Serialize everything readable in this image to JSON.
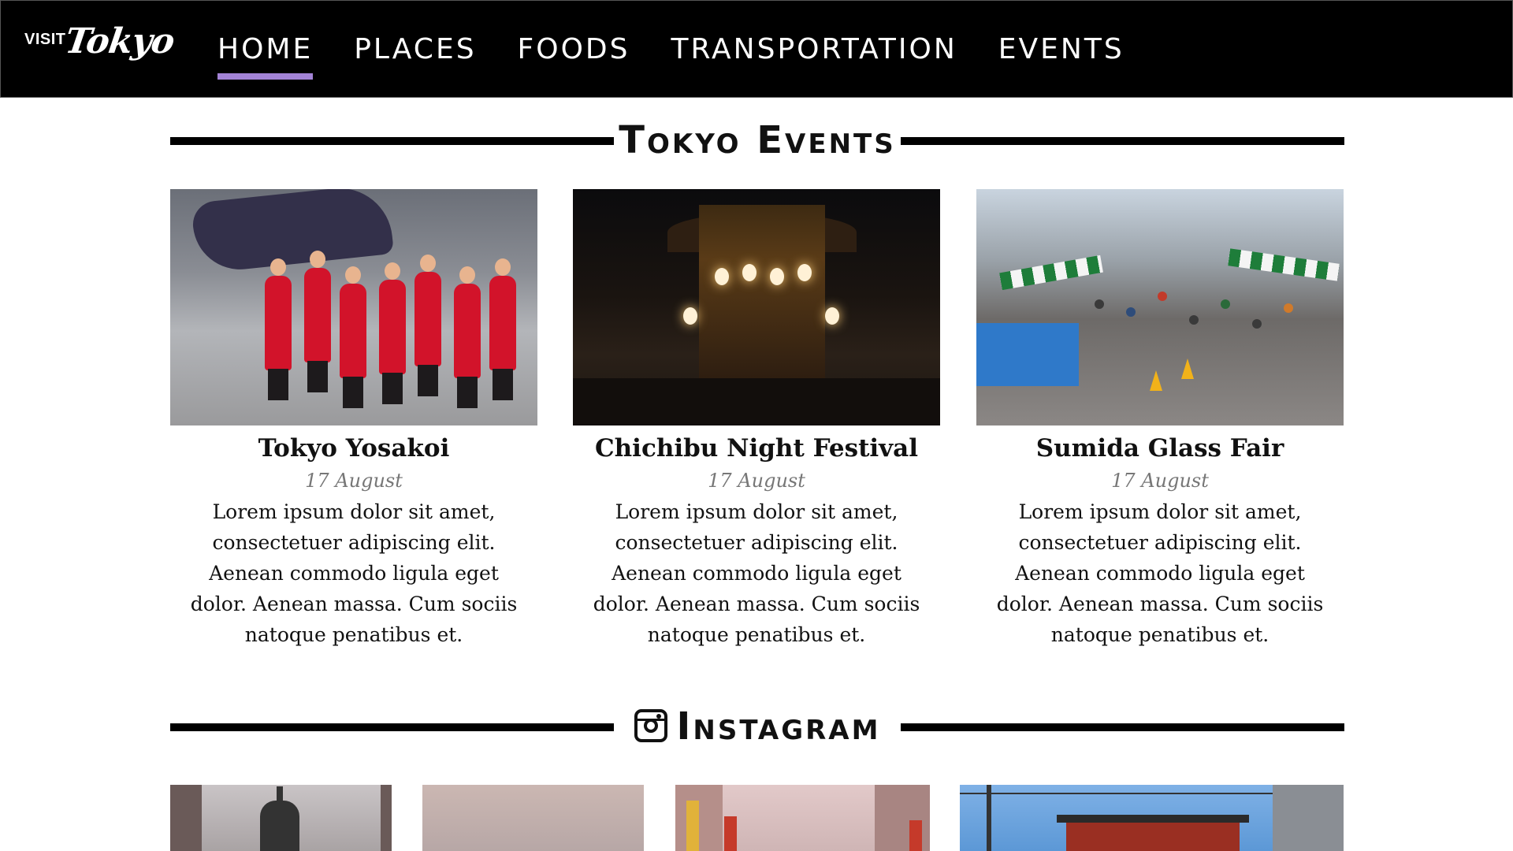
{
  "header": {
    "logo": {
      "visit": "VISIT",
      "tokyo": "Tokyo"
    },
    "nav": [
      {
        "label": "HOME",
        "active": true
      },
      {
        "label": "PLACES",
        "active": false
      },
      {
        "label": "FOODS",
        "active": false
      },
      {
        "label": "TRANSPORTATION",
        "active": false
      },
      {
        "label": "EVENTS",
        "active": false
      }
    ],
    "accent_color": "#a383d6"
  },
  "events": {
    "title": "Tokyo Events",
    "cards": [
      {
        "title": "Tokyo Yosakoi",
        "date": "17 August",
        "text": "Lorem ipsum dolor sit amet, consectetuer adipiscing elit. Aenean commodo ligula eget dolor. Aenean massa. Cum sociis natoque penatibus et."
      },
      {
        "title": "Chichibu Night Festival",
        "date": "17 August",
        "text": "Lorem ipsum dolor sit amet, consectetuer adipiscing elit. Aenean commodo ligula eget dolor. Aenean massa. Cum sociis natoque penatibus et."
      },
      {
        "title": "Sumida Glass Fair",
        "date": "17 August",
        "text": "Lorem ipsum dolor sit amet, consectetuer adipiscing elit. Aenean commodo ligula eget dolor. Aenean massa. Cum sociis natoque penatibus et."
      }
    ]
  },
  "instagram": {
    "title": "Instagram",
    "icon": "instagram-icon"
  }
}
